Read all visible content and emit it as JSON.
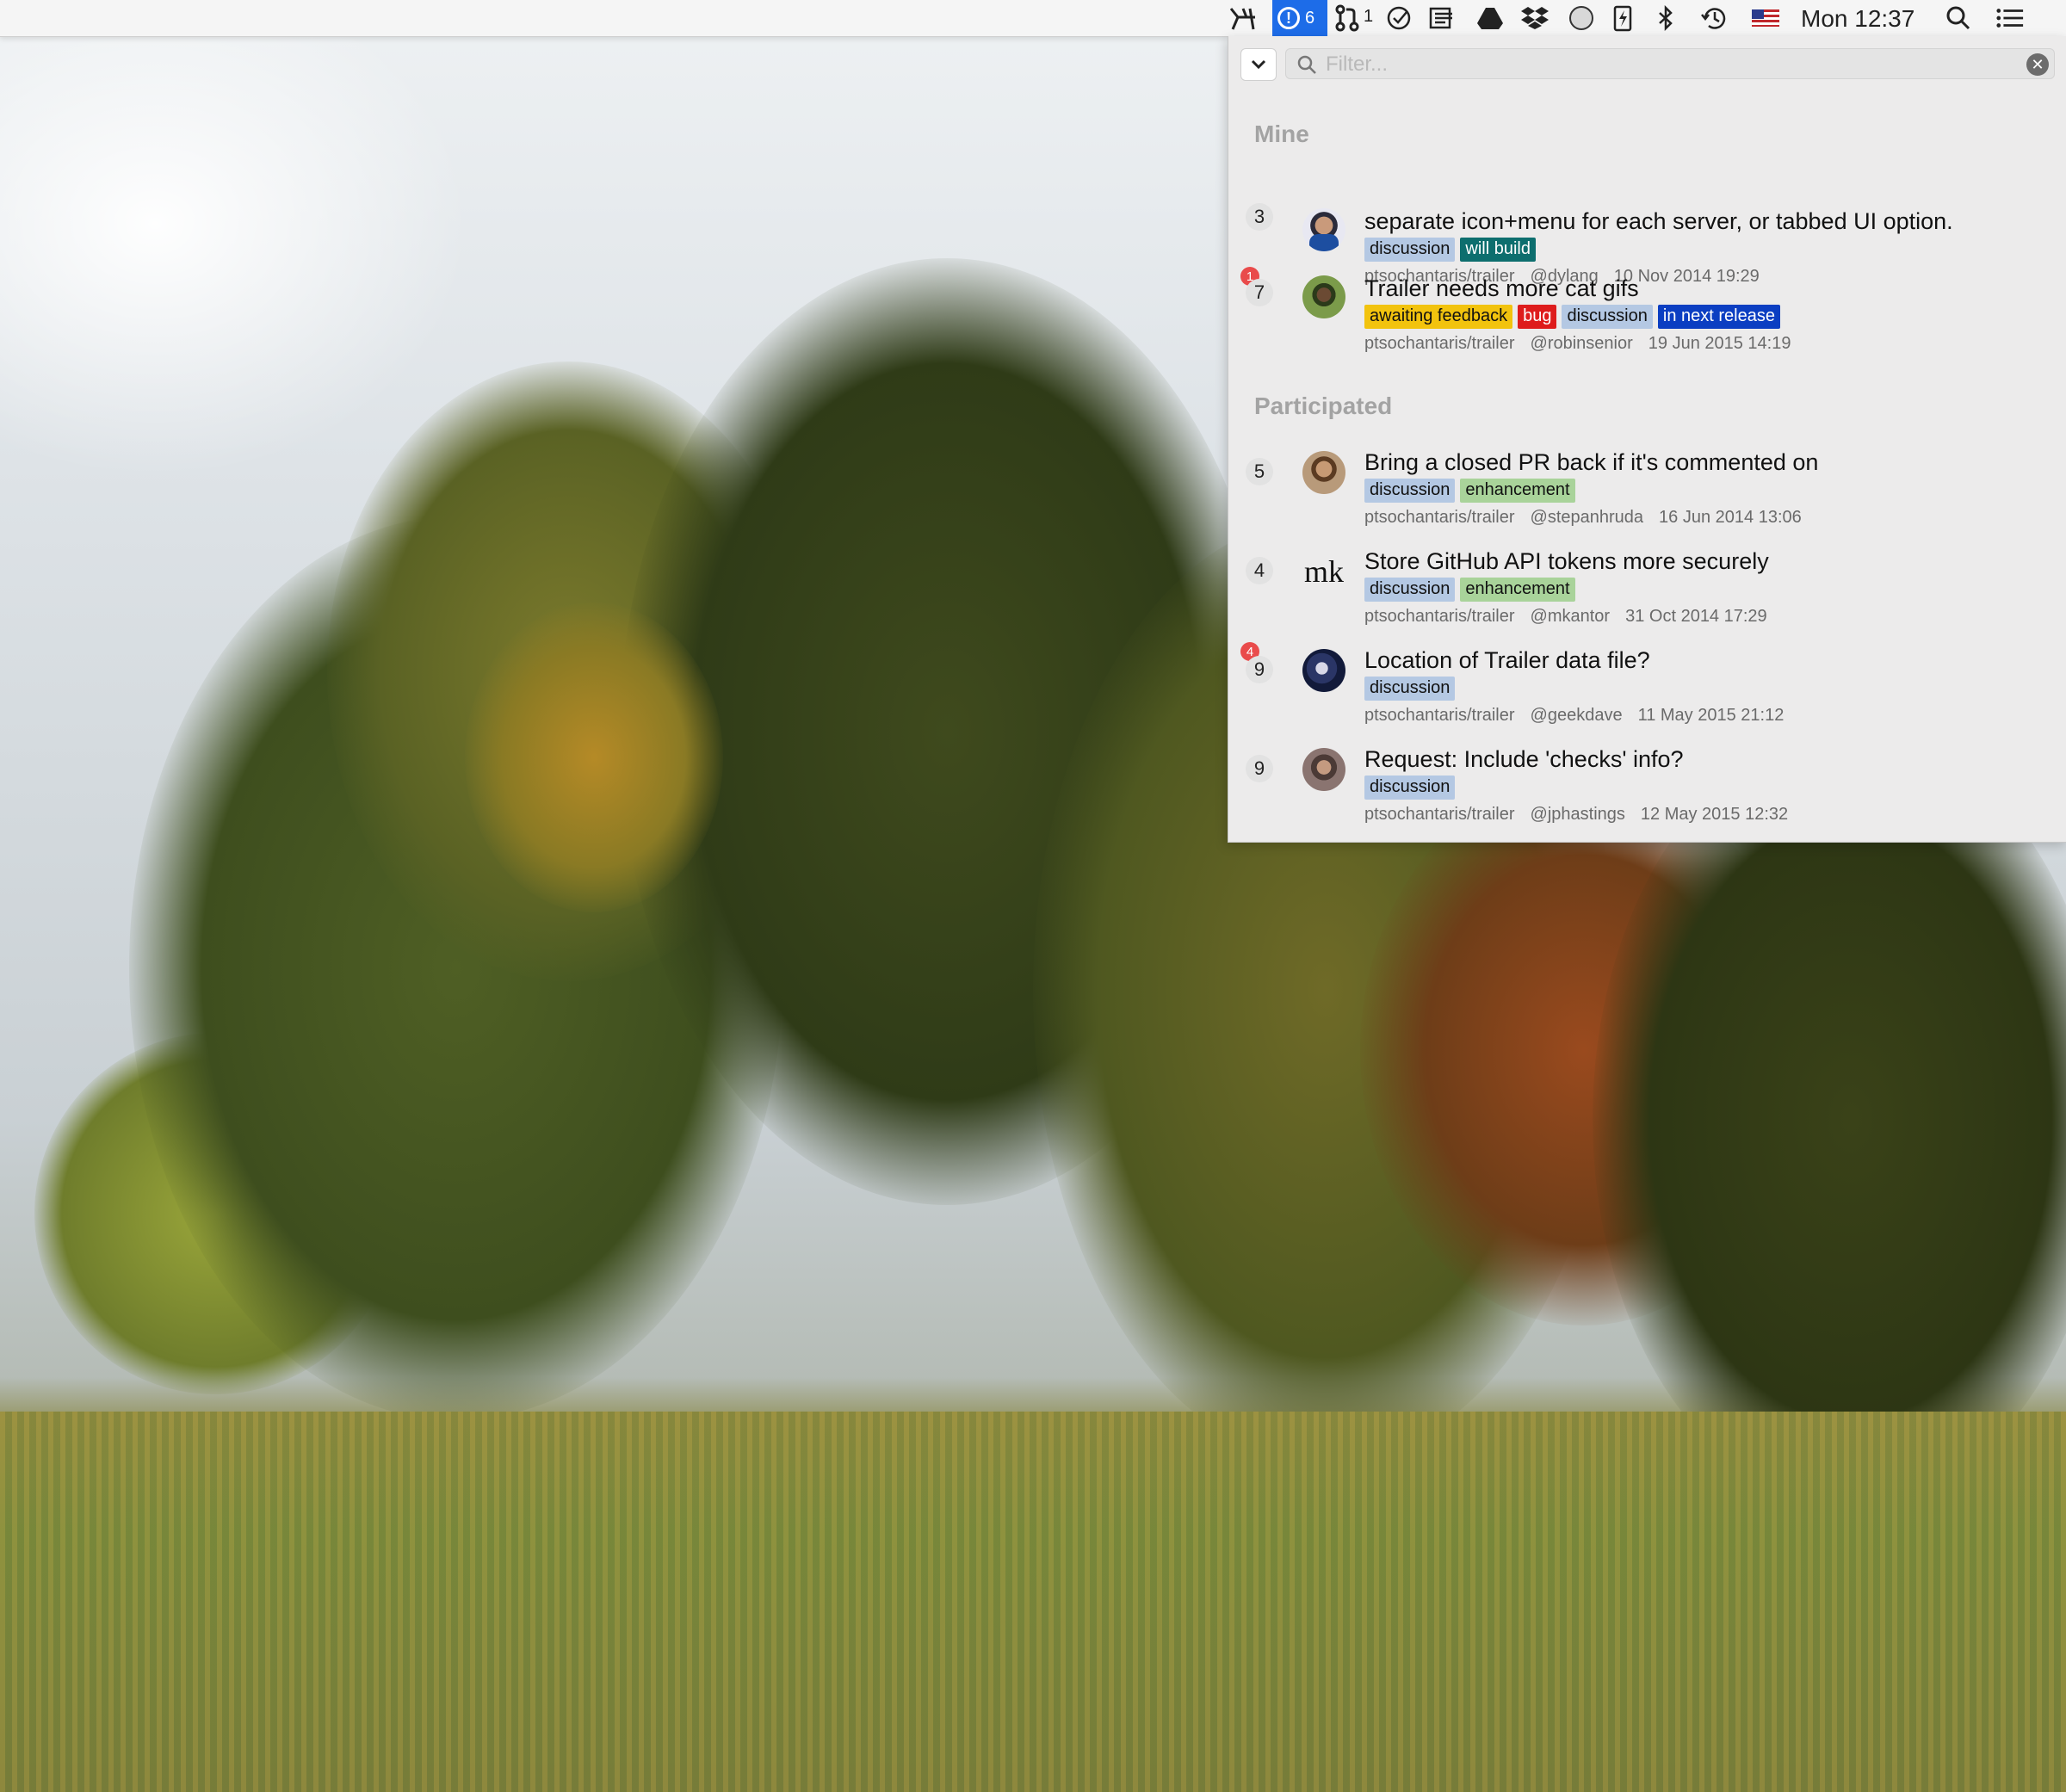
{
  "menubar": {
    "active_item_count": "6",
    "pr_count": "1",
    "clock": "Mon 12:37"
  },
  "filter": {
    "placeholder": "Filter..."
  },
  "colors": {
    "discussion": "#b4c8e3",
    "will_build": "#0d6e6e",
    "awaiting_feedback": "#f2c30e",
    "bug": "#de1c1c",
    "in_next_release": "#0b3ec2",
    "enhancement": "#a9d39a",
    "unread": "#e94b4b",
    "menubar_highlight": "#1d6ce8"
  },
  "sections": {
    "mine": {
      "title": "Mine",
      "items": [
        {
          "comments": "3",
          "unread": "",
          "title": "separate icon+menu for each server, or tabbed UI option.",
          "labels": [
            "discussion",
            "will build"
          ],
          "repo": "ptsochantaris/trailer",
          "author": "@dylang",
          "date": "10 Nov 2014 19:29"
        },
        {
          "comments": "7",
          "unread": "1",
          "title": "Trailer needs more cat gifs",
          "labels": [
            "awaiting feedback",
            "bug",
            "discussion",
            "in next release"
          ],
          "repo": "ptsochantaris/trailer",
          "author": "@robinsenior",
          "date": "19 Jun 2015 14:19"
        }
      ]
    },
    "participated": {
      "title": "Participated",
      "items": [
        {
          "comments": "5",
          "unread": "",
          "title": "Bring a closed PR back if it's commented on",
          "labels": [
            "discussion",
            "enhancement"
          ],
          "repo": "ptsochantaris/trailer",
          "author": "@stepanhruda",
          "date": "16 Jun 2014 13:06"
        },
        {
          "comments": "4",
          "unread": "",
          "avatar_text": "mk",
          "title": "Store GitHub API tokens more securely",
          "labels": [
            "discussion",
            "enhancement"
          ],
          "repo": "ptsochantaris/trailer",
          "author": "@mkantor",
          "date": "31 Oct 2014 17:29"
        },
        {
          "comments": "9",
          "unread": "4",
          "title": "Location of Trailer data file?",
          "labels": [
            "discussion"
          ],
          "repo": "ptsochantaris/trailer",
          "author": "@geekdave",
          "date": "11 May 2015 21:12"
        },
        {
          "comments": "9",
          "unread": "",
          "title": "Request: Include 'checks' info?",
          "labels": [
            "discussion"
          ],
          "repo": "ptsochantaris/trailer",
          "author": "@jphastings",
          "date": "12 May 2015 12:32"
        }
      ]
    }
  }
}
